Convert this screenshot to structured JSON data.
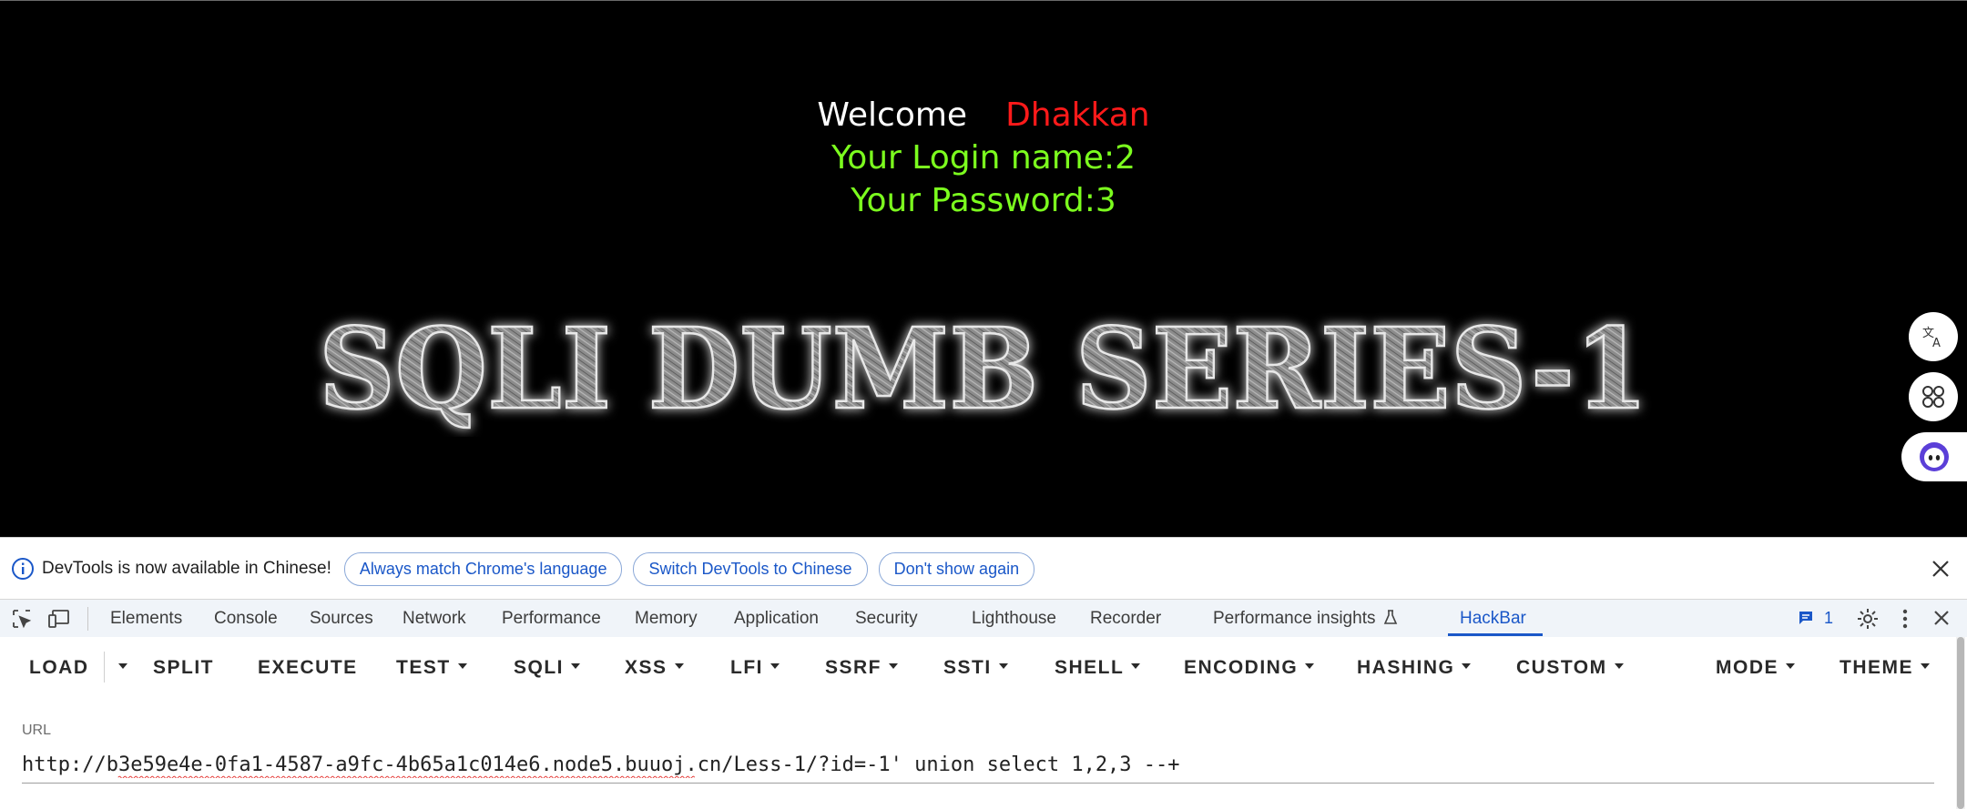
{
  "page": {
    "welcome": "Welcome",
    "user": "Dhakkan",
    "login_line": "Your Login name:2",
    "password_line": "Your Password:3",
    "banner": "SQLI DUMB SERIES-1"
  },
  "side_icons": [
    "translate-icon",
    "apps-icon",
    "assistant-icon"
  ],
  "notice": {
    "text": "DevTools is now available in Chinese!",
    "buttons": [
      "Always match Chrome's language",
      "Switch DevTools to Chinese",
      "Don't show again"
    ]
  },
  "devtools": {
    "tabs": [
      "Elements",
      "Console",
      "Sources",
      "Network",
      "Performance",
      "Memory",
      "Application",
      "Security",
      "Lighthouse",
      "Recorder",
      "Performance insights",
      "HackBar"
    ],
    "active_tab": "HackBar",
    "issues_count": "1"
  },
  "hackbar": {
    "menu": [
      "LOAD",
      "SPLIT",
      "EXECUTE",
      "TEST",
      "SQLI",
      "XSS",
      "LFI",
      "SSRF",
      "SSTI",
      "SHELL",
      "ENCODING",
      "HASHING",
      "CUSTOM",
      "MODE",
      "THEME"
    ],
    "url_label": "URL",
    "url_value": "http://b3e59e4e-0fa1-4587-a9fc-4b65a1c014e6.node5.buuoj.cn/Less-1/?id=-1' union select 1,2,3 --+"
  },
  "colors": {
    "accent": "#1a57c8",
    "welcome_user": "#ff1a1a",
    "info_text": "#7cff1e"
  }
}
